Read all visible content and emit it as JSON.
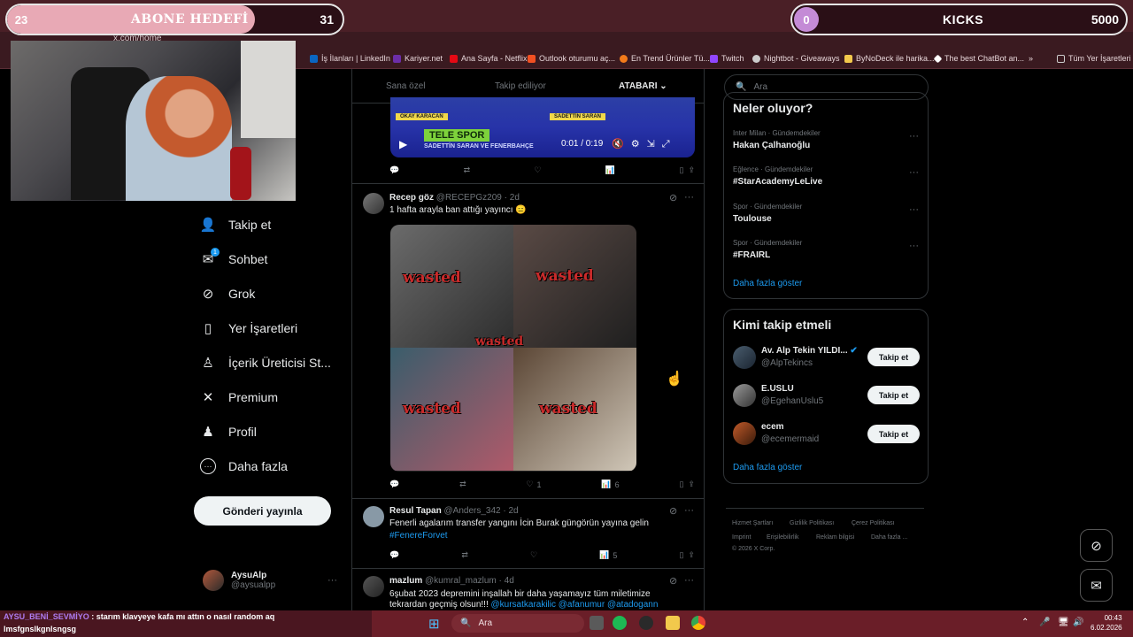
{
  "browser": {
    "url": "x.com/home",
    "bookmarks": [
      {
        "label": "İş İlanları | LinkedIn",
        "color": "#0a66c2"
      },
      {
        "label": "Kariyer.net",
        "color": "#6c2ea8"
      },
      {
        "label": "Ana Sayfa - Netflix",
        "color": "#e50914"
      },
      {
        "label": "Outlook oturumu aç...",
        "color": "#f25022"
      },
      {
        "label": "En Trend Ürünler Tü...",
        "color": "#f27a1a"
      },
      {
        "label": "Twitch",
        "color": "#9146ff"
      },
      {
        "label": "Nightbot - Giveaways",
        "color": "#cccccc"
      },
      {
        "label": "ByNoDeck ile harika...",
        "color": "#f2c94c"
      },
      {
        "label": "The best ChatBot an...",
        "color": "#ffffff"
      }
    ],
    "bookmarks_more": "»",
    "all_bookmarks": "Tüm Yer İşaretleri"
  },
  "overlay": {
    "sub_goal": {
      "current": "23",
      "title": "ABONE HEDEFİ",
      "target": "31",
      "progress": 0.74
    },
    "kicks_goal": {
      "current": "0",
      "title": "KICKS",
      "target": "5000"
    }
  },
  "nav": [
    {
      "label": "Takip et",
      "icon": "person-add-icon",
      "glyph": "👤"
    },
    {
      "label": "Sohbet",
      "icon": "mail-icon",
      "glyph": "✉"
    },
    {
      "label": "Grok",
      "icon": "grok-icon",
      "glyph": "⊘"
    },
    {
      "label": "Yer İşaretleri",
      "icon": "bookmark-icon",
      "glyph": "🔖"
    },
    {
      "label": "İçerik Üreticisi St...",
      "icon": "creator-studio-icon",
      "glyph": "♙"
    },
    {
      "label": "Premium",
      "icon": "x-logo-icon",
      "glyph": "✕"
    },
    {
      "label": "Profil",
      "icon": "profile-icon",
      "glyph": "👤"
    },
    {
      "label": "Daha fazla",
      "icon": "more-circle-icon",
      "glyph": "⋯"
    }
  ],
  "nav_badge": "1",
  "post_button": "Gönderi yayınla",
  "account": {
    "name": "AysuAlp",
    "handle": "@aysualpp",
    "more": "···"
  },
  "tabs": [
    "Sana özel",
    "Takip ediliyor",
    "ATABARI"
  ],
  "video": {
    "tag1": "OKAY KARACAN",
    "tag2": "SADETTİN SARAN",
    "banner": "TELE SPOR",
    "subtitle": "SADETTİN SARAN VE FENERBAHÇE",
    "time": "0:01 / 0:19"
  },
  "tweets": [
    {
      "name": "Recep göz",
      "handle": "@RECEPGz209",
      "time": "· 2d",
      "text": "1 hafta arayla ban attığı yayıncı 😑",
      "likes": "1",
      "views": "6",
      "image_labels": [
        "wasted",
        "wasted",
        "wasted",
        "wasted",
        "wasted"
      ]
    },
    {
      "name": "Resul Tapan",
      "handle": "@Anders_342",
      "time": "· 2d",
      "text": "Fenerli agalarım transfer yangını İcin Burak güngörün yayına gelin",
      "hashtag": "#FenereForvet",
      "likes": "",
      "views": "5"
    },
    {
      "name": "mazlum",
      "handle": "@kumral_mazlum",
      "time": "· 4d",
      "text": "6şubat 2023 depremini inşallah bir daha yaşamayız tüm miletimize",
      "text2": "tekrardan geçmiş olsun!!!",
      "mentions": "@kursatkarakilic @afanumur @atadogann"
    }
  ],
  "search": {
    "placeholder": "Ara"
  },
  "trends": {
    "title": "Neler oluyor?",
    "items": [
      {
        "meta": "Inter Milan · Gündemdekiler",
        "name": "Hakan Çalhanoğlu"
      },
      {
        "meta": "Eğlence · Gündemdekiler",
        "name": "#StarAcademyLeLive"
      },
      {
        "meta": "Spor · Gündemdekiler",
        "name": "Toulouse"
      },
      {
        "meta": "Spor · Gündemdekiler",
        "name": "#FRAIRL"
      }
    ],
    "show_more": "Daha fazla göster"
  },
  "who_to_follow": {
    "title": "Kimi takip etmeli",
    "items": [
      {
        "name": "Av. Alp Tekin YILDI...",
        "handle": "@AlpTekincs",
        "verified": true,
        "button": "Takip et"
      },
      {
        "name": "E.USLU",
        "handle": "@EgehanUslu5",
        "verified": false,
        "button": "Takip et"
      },
      {
        "name": "ecem",
        "handle": "@ecemermaid",
        "verified": false,
        "button": "Takip et"
      }
    ],
    "show_more": "Daha fazla göster"
  },
  "footer": {
    "links": [
      "Hizmet Şartları",
      "Gizlilik Politikası",
      "Çerez Politikası",
      "Imprint",
      "Erişilebilirlik",
      "Reklam bilgisi",
      "Daha fazla ..."
    ],
    "copyright": "© 2026 X Corp."
  },
  "chat": {
    "user": "AYSU_BENİ_SEVMİYO",
    "message": ": starım klavyeye kafa mı attın o nasıl random aq",
    "line2": "lmsfgnslkgnlsngsg"
  },
  "taskbar": {
    "search": "Ara",
    "time": "00:43",
    "date": "6.02.2026"
  },
  "colors": {
    "accent": "#1d9bf0",
    "bg": "#000000",
    "goal_fill": "#e8a9b5",
    "kicks_fill": "#c48bd6"
  }
}
